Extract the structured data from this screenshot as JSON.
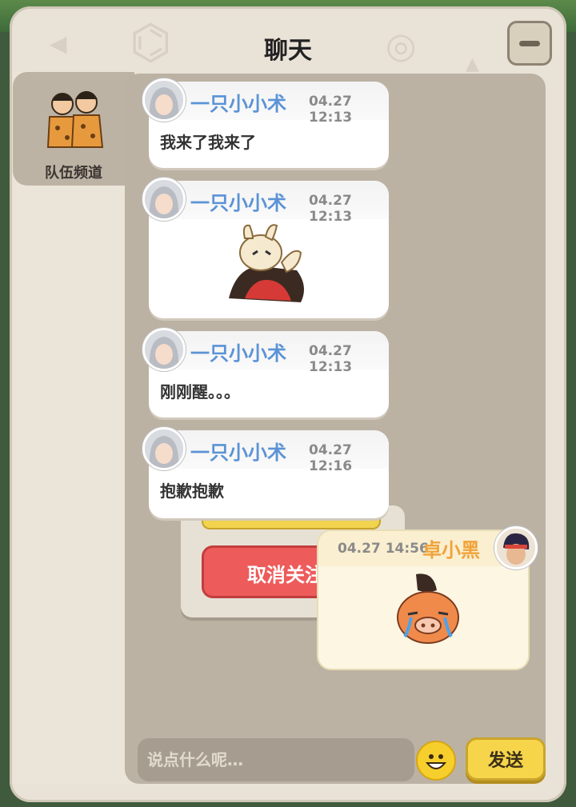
{
  "window": {
    "title": "聊天"
  },
  "sidebar": {
    "tab_label": "队伍频道"
  },
  "messages": [
    {
      "sender": "一只小小术",
      "time": "04.27 12:13",
      "text": "我来了我来了"
    },
    {
      "sender": "一只小小术",
      "time": "04.27 12:13",
      "sticker": "rabbit-sticker"
    },
    {
      "sender": "一只小小术",
      "time": "04.27 12:13",
      "text": "刚刚醒。。。"
    },
    {
      "sender": "一只小小术",
      "time": "04.27 12:16",
      "text": "抱歉抱歉"
    }
  ],
  "my_message": {
    "sender": "卓小黑",
    "time": "04.27 14:56",
    "sticker": "crying-boar-sticker"
  },
  "overlay": {
    "cancel_label": "取消关注"
  },
  "composer": {
    "placeholder": "说点什么呢…",
    "send_label": "发送"
  },
  "colors": {
    "other_name": "#5b93d6",
    "my_name": "#f0a33a",
    "send_button": "#f6d54a",
    "cancel_button": "#ee5b5b"
  }
}
